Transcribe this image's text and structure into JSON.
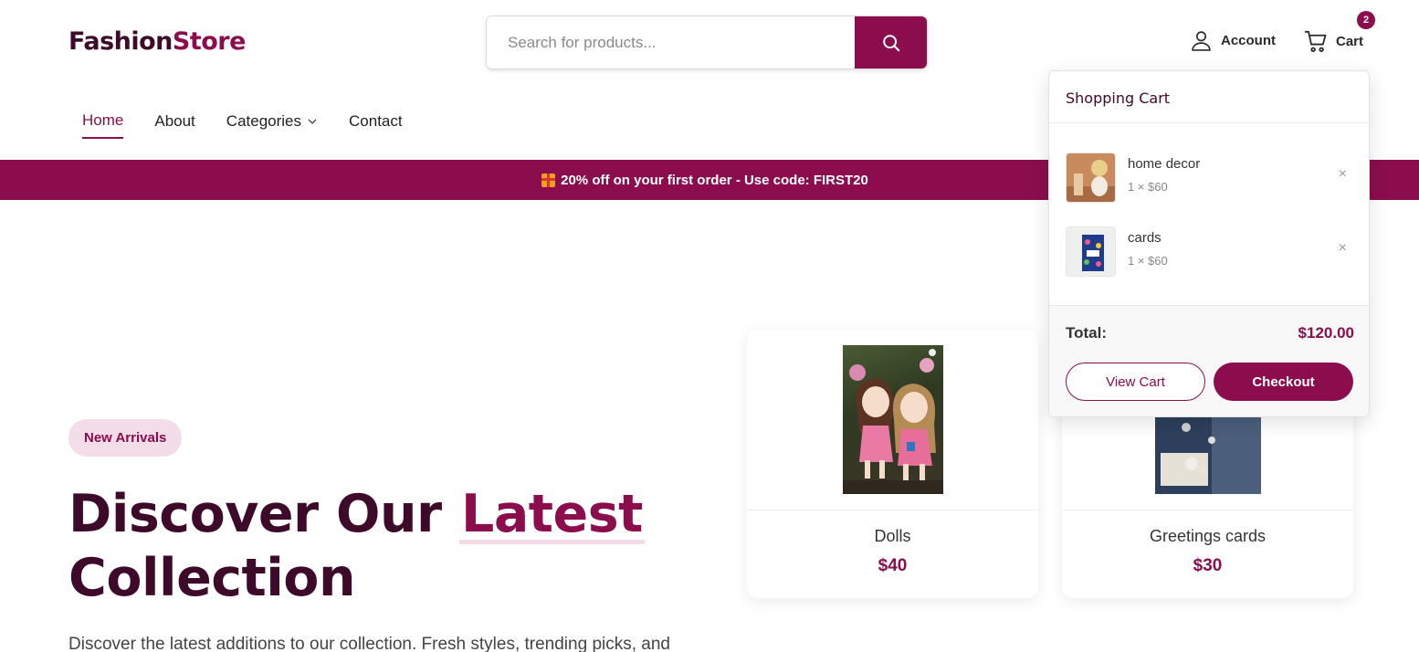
{
  "brand": {
    "part1": "Fashion",
    "part2": "Store"
  },
  "search": {
    "placeholder": "Search for products..."
  },
  "header": {
    "account_label": "Account",
    "cart_label": "Cart",
    "cart_count": "2"
  },
  "nav": {
    "items": [
      {
        "label": "Home"
      },
      {
        "label": "About"
      },
      {
        "label": "Categories"
      },
      {
        "label": "Contact"
      }
    ]
  },
  "promo": {
    "text": "20% off on your first order - Use code: FIRST20"
  },
  "hero": {
    "badge": "New Arrivals",
    "title_part1": "Discover Our ",
    "title_accent": "Latest",
    "title_part2": "Collection",
    "description": "Discover the latest additions to our collection. Fresh styles, trending picks, and"
  },
  "products": [
    {
      "name": "Dolls",
      "price": "$40"
    },
    {
      "name": "Greetings cards",
      "price": "$30"
    }
  ],
  "mini_cart": {
    "title": "Shopping Cart",
    "items": [
      {
        "name": "home decor",
        "qty_price": "1 × $60",
        "remove": "×"
      },
      {
        "name": "cards",
        "qty_price": "1 × $60",
        "remove": "×"
      }
    ],
    "total_label": "Total:",
    "total_value": "$120.00",
    "view_cart_label": "View Cart",
    "checkout_label": "Checkout"
  },
  "colors": {
    "brand": "#8b0d4e",
    "brand_dark": "#3d0a2a",
    "accent_soft": "#f3dde8"
  },
  "icons": [
    "search-icon",
    "user-icon",
    "cart-icon",
    "chevron-down-icon",
    "gift-icon",
    "close-icon"
  ]
}
